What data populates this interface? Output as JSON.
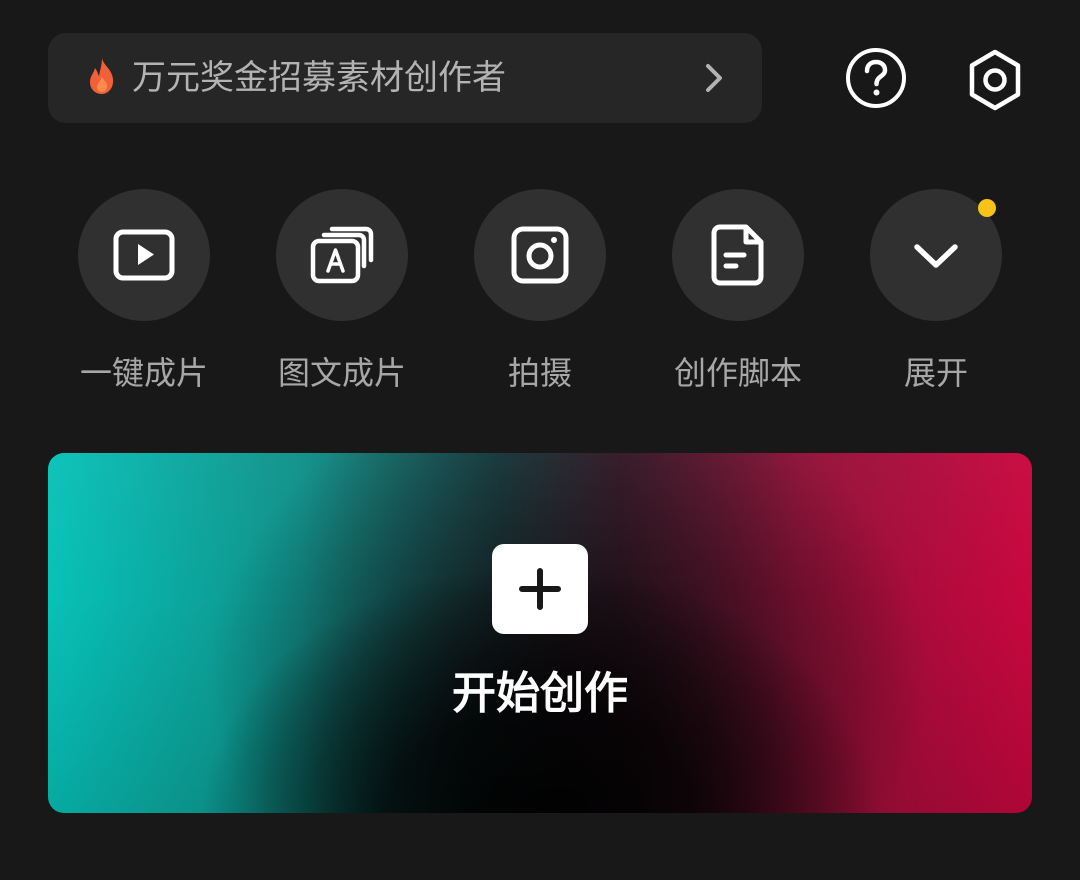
{
  "banner": {
    "text": "万元奖金招募素材创作者",
    "leading_icon": "fire-icon",
    "trailing_icon": "chevron-right-icon"
  },
  "header_actions": {
    "help_icon": "help-icon",
    "settings_icon": "settings-icon"
  },
  "tools": [
    {
      "label": "一键成片",
      "icon": "play-video-icon"
    },
    {
      "label": "图文成片",
      "icon": "text-slides-icon"
    },
    {
      "label": "拍摄",
      "icon": "camera-icon"
    },
    {
      "label": "创作脚本",
      "icon": "script-icon"
    },
    {
      "label": "展开",
      "icon": "chevron-down-icon",
      "has_notification_dot": true
    }
  ],
  "create": {
    "label": "开始创作",
    "icon": "plus-icon"
  },
  "colors": {
    "background": "#181818",
    "banner_bg": "#262626",
    "tool_circle_bg": "#303030",
    "label_gray": "#a7a7a7",
    "notification_dot": "#f7c21a",
    "gradient_teal": "#07c2b8",
    "gradient_red": "#c8073e",
    "fire_orange": "#f2603a"
  }
}
